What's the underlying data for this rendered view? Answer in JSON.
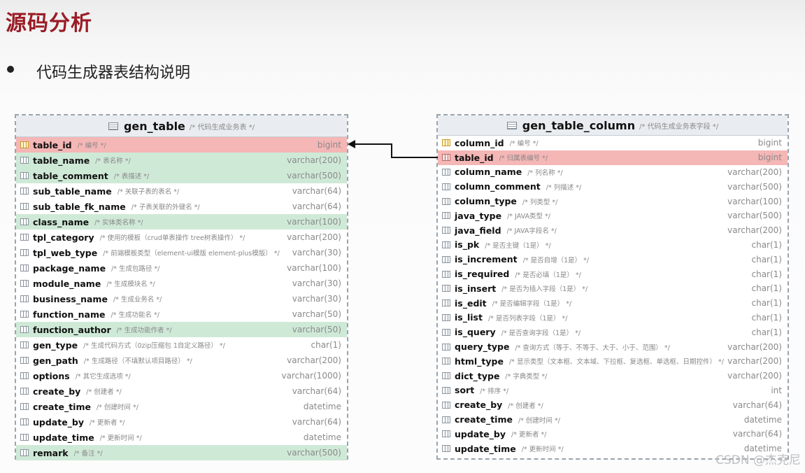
{
  "page": {
    "title": "源码分析",
    "subtitle": "代码生成器表结构说明",
    "watermark": "CSDN @杰克尼"
  },
  "colors": {
    "title": "#9a1c26",
    "pk_row": "#f5b6b6",
    "highlight_row": "#cfe9d7",
    "border": "#9aa4ad"
  },
  "gen_table": {
    "name": "gen_table",
    "comment": "/* 代码生成业务表 */",
    "columns": [
      {
        "name": "table_id",
        "comment": "/* 编号 */",
        "type": "bigint",
        "hl": "pk",
        "icon": "primary-key-icon"
      },
      {
        "name": "table_name",
        "comment": "/* 表名称 */",
        "type": "varchar(200)",
        "hl": "green",
        "icon": "column-icon"
      },
      {
        "name": "table_comment",
        "comment": "/* 表描述 */",
        "type": "varchar(500)",
        "hl": "green",
        "icon": "column-icon"
      },
      {
        "name": "sub_table_name",
        "comment": "/* 关联子表的表名 */",
        "type": "varchar(64)",
        "hl": "",
        "icon": "column-icon"
      },
      {
        "name": "sub_table_fk_name",
        "comment": "/* 子表关联的外键名 */",
        "type": "varchar(64)",
        "hl": "",
        "icon": "column-icon"
      },
      {
        "name": "class_name",
        "comment": "/* 实体类名称 */",
        "type": "varchar(100)",
        "hl": "green",
        "icon": "column-icon"
      },
      {
        "name": "tpl_category",
        "comment": "/* 使用的模板（crud单表操作 tree树表操作） */",
        "type": "varchar(200)",
        "hl": "",
        "icon": "column-icon"
      },
      {
        "name": "tpl_web_type",
        "comment": "/* 前端模板类型（element-ui模版 element-plus模版） */",
        "type": "varchar(30)",
        "hl": "",
        "icon": "column-icon"
      },
      {
        "name": "package_name",
        "comment": "/* 生成包路径 */",
        "type": "varchar(100)",
        "hl": "",
        "icon": "column-icon"
      },
      {
        "name": "module_name",
        "comment": "/* 生成模块名 */",
        "type": "varchar(30)",
        "hl": "",
        "icon": "column-icon"
      },
      {
        "name": "business_name",
        "comment": "/* 生成业务名 */",
        "type": "varchar(30)",
        "hl": "",
        "icon": "column-icon"
      },
      {
        "name": "function_name",
        "comment": "/* 生成功能名 */",
        "type": "varchar(50)",
        "hl": "",
        "icon": "column-icon"
      },
      {
        "name": "function_author",
        "comment": "/* 生成功能作者 */",
        "type": "varchar(50)",
        "hl": "green",
        "icon": "column-icon"
      },
      {
        "name": "gen_type",
        "comment": "/* 生成代码方式（0zip压缩包 1自定义路径） */",
        "type": "char(1)",
        "hl": "",
        "icon": "column-icon"
      },
      {
        "name": "gen_path",
        "comment": "/* 生成路径（不填默认项目路径） */",
        "type": "varchar(200)",
        "hl": "",
        "icon": "column-icon"
      },
      {
        "name": "options",
        "comment": "/* 其它生成选项 */",
        "type": "varchar(1000)",
        "hl": "",
        "icon": "column-icon"
      },
      {
        "name": "create_by",
        "comment": "/* 创建者 */",
        "type": "varchar(64)",
        "hl": "",
        "icon": "column-icon"
      },
      {
        "name": "create_time",
        "comment": "/* 创建时间 */",
        "type": "datetime",
        "hl": "",
        "icon": "column-icon"
      },
      {
        "name": "update_by",
        "comment": "/* 更新者 */",
        "type": "varchar(64)",
        "hl": "",
        "icon": "column-icon"
      },
      {
        "name": "update_time",
        "comment": "/* 更新时间 */",
        "type": "datetime",
        "hl": "",
        "icon": "column-icon"
      },
      {
        "name": "remark",
        "comment": "/* 备注 */",
        "type": "varchar(500)",
        "hl": "green",
        "icon": "column-icon"
      }
    ]
  },
  "gen_table_column": {
    "name": "gen_table_column",
    "comment": "/* 代码生成业务表字段 */",
    "columns": [
      {
        "name": "column_id",
        "comment": "/* 编号 */",
        "type": "bigint",
        "hl": "",
        "icon": "primary-key-icon"
      },
      {
        "name": "table_id",
        "comment": "/* 归属表编号 */",
        "type": "bigint",
        "hl": "pk",
        "icon": "foreign-key-icon"
      },
      {
        "name": "column_name",
        "comment": "/* 列名称 */",
        "type": "varchar(200)",
        "hl": "",
        "icon": "column-icon"
      },
      {
        "name": "column_comment",
        "comment": "/* 列描述 */",
        "type": "varchar(500)",
        "hl": "",
        "icon": "column-icon"
      },
      {
        "name": "column_type",
        "comment": "/* 列类型 */",
        "type": "varchar(100)",
        "hl": "",
        "icon": "column-icon"
      },
      {
        "name": "java_type",
        "comment": "/* JAVA类型 */",
        "type": "varchar(500)",
        "hl": "",
        "icon": "column-icon"
      },
      {
        "name": "java_field",
        "comment": "/* JAVA字段名 */",
        "type": "varchar(200)",
        "hl": "",
        "icon": "column-icon"
      },
      {
        "name": "is_pk",
        "comment": "/* 是否主键（1是） */",
        "type": "char(1)",
        "hl": "",
        "icon": "column-icon"
      },
      {
        "name": "is_increment",
        "comment": "/* 是否自增（1是） */",
        "type": "char(1)",
        "hl": "",
        "icon": "column-icon"
      },
      {
        "name": "is_required",
        "comment": "/* 是否必填（1是） */",
        "type": "char(1)",
        "hl": "",
        "icon": "column-icon"
      },
      {
        "name": "is_insert",
        "comment": "/* 是否为插入字段（1是） */",
        "type": "char(1)",
        "hl": "",
        "icon": "column-icon"
      },
      {
        "name": "is_edit",
        "comment": "/* 是否编辑字段（1是） */",
        "type": "char(1)",
        "hl": "",
        "icon": "column-icon"
      },
      {
        "name": "is_list",
        "comment": "/* 是否列表字段（1是） */",
        "type": "char(1)",
        "hl": "",
        "icon": "column-icon"
      },
      {
        "name": "is_query",
        "comment": "/* 是否查询字段（1是） */",
        "type": "char(1)",
        "hl": "",
        "icon": "column-icon"
      },
      {
        "name": "query_type",
        "comment": "/* 查询方式（等于、不等于、大于、小于、范围） */",
        "type": "varchar(200)",
        "hl": "",
        "icon": "column-icon"
      },
      {
        "name": "html_type",
        "comment": "/* 显示类型（文本框、文本域、下拉框、复选框、单选框、日期控件） */",
        "type": "varchar(200)",
        "hl": "",
        "icon": "column-icon"
      },
      {
        "name": "dict_type",
        "comment": "/* 字典类型 */",
        "type": "varchar(200)",
        "hl": "",
        "icon": "column-icon"
      },
      {
        "name": "sort",
        "comment": "/* 排序 */",
        "type": "int",
        "hl": "",
        "icon": "column-icon"
      },
      {
        "name": "create_by",
        "comment": "/* 创建者 */",
        "type": "varchar(64)",
        "hl": "",
        "icon": "column-icon"
      },
      {
        "name": "create_time",
        "comment": "/* 创建时间 */",
        "type": "datetime",
        "hl": "",
        "icon": "column-icon"
      },
      {
        "name": "update_by",
        "comment": "/* 更新者 */",
        "type": "varchar(64)",
        "hl": "",
        "icon": "column-icon"
      },
      {
        "name": "update_time",
        "comment": "/* 更新时间 */",
        "type": "datetime",
        "hl": "",
        "icon": "column-icon"
      }
    ]
  }
}
